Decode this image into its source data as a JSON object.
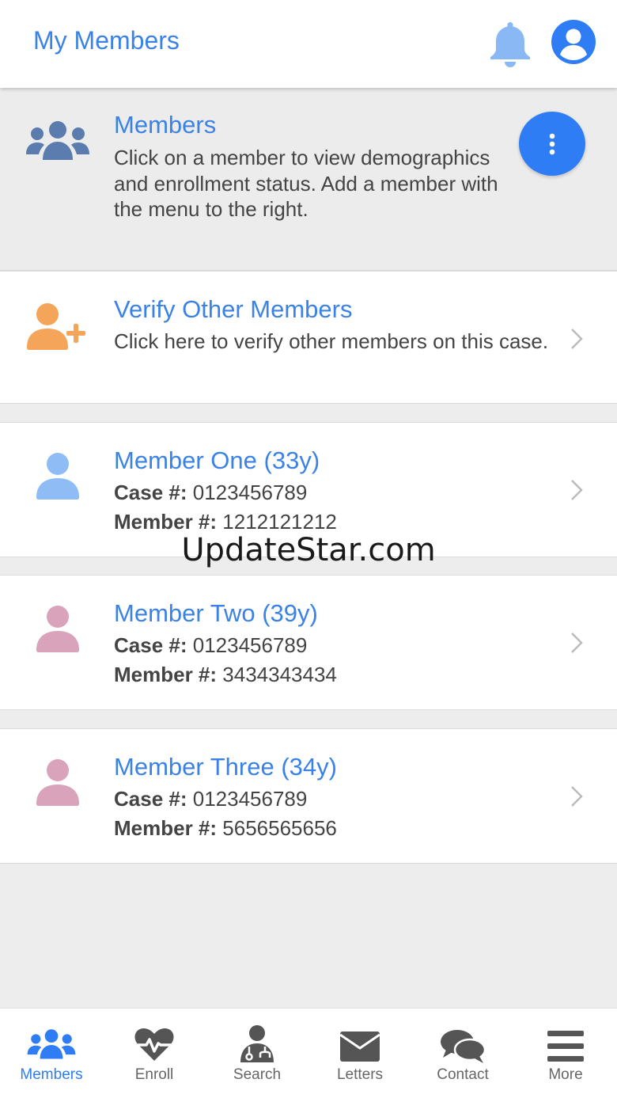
{
  "header": {
    "title": "My Members"
  },
  "members_section": {
    "title": "Members",
    "description": "Click on a member to view demographics and enrollment status. Add a member with the menu to the right."
  },
  "verify": {
    "title": "Verify Other Members",
    "description": "Click here to verify other members on this case."
  },
  "labels": {
    "case": "Case #:",
    "member": "Member #:"
  },
  "members": [
    {
      "name": "Member One (33y)",
      "case_no": "0123456789",
      "member_no": "1212121212",
      "avatar_color": "#8fbcf5"
    },
    {
      "name": "Member Two (39y)",
      "case_no": "0123456789",
      "member_no": "3434343434",
      "avatar_color": "#d9a3bb"
    },
    {
      "name": "Member Three (34y)",
      "case_no": "0123456789",
      "member_no": "5656565656",
      "avatar_color": "#d9a3bb"
    }
  ],
  "watermark": "UpdateStar.com",
  "nav": [
    {
      "label": "Members",
      "icon": "users-icon",
      "active": true
    },
    {
      "label": "Enroll",
      "icon": "heartbeat-icon",
      "active": false
    },
    {
      "label": "Search",
      "icon": "doctor-icon",
      "active": false
    },
    {
      "label": "Letters",
      "icon": "envelope-icon",
      "active": false
    },
    {
      "label": "Contact",
      "icon": "chat-icon",
      "active": false
    },
    {
      "label": "More",
      "icon": "menu-icon",
      "active": false
    }
  ],
  "colors": {
    "accent": "#3b82e6",
    "fab": "#2f7df4",
    "bell": "#8ab8f5",
    "verify_icon": "#f5a55a",
    "members_icon": "#5a7cae"
  }
}
